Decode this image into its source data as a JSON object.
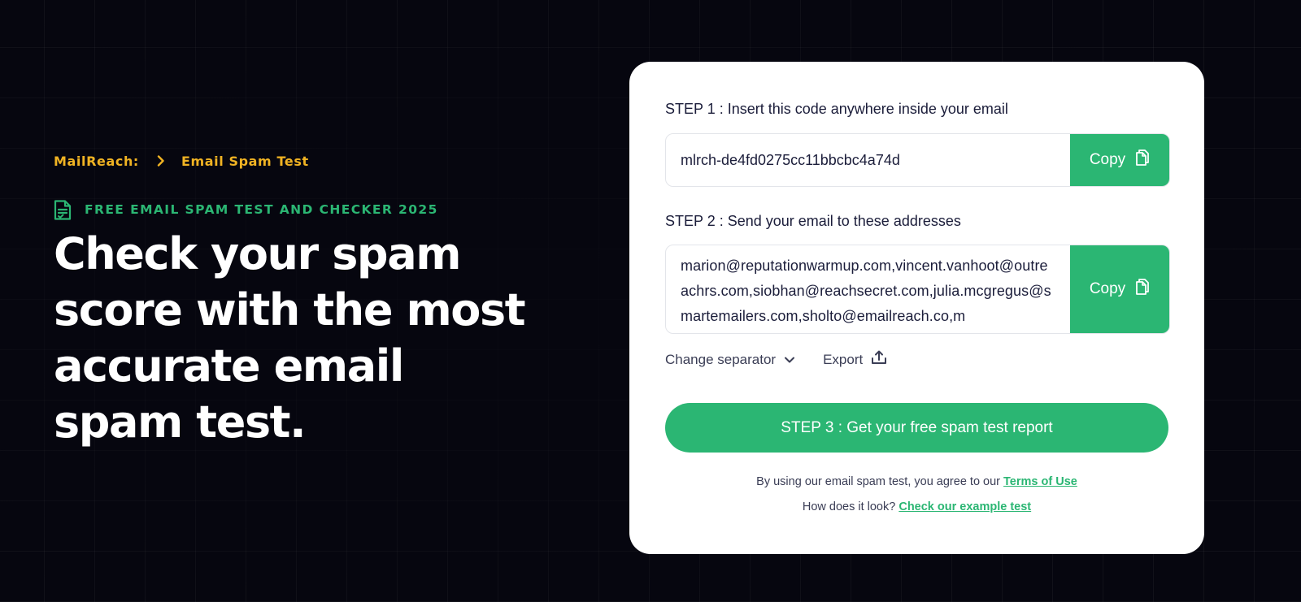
{
  "breadcrumb": {
    "home": "MailReach:",
    "current": "Email Spam Test"
  },
  "hero": {
    "eyebrow": "FREE EMAIL SPAM TEST AND CHECKER 2025",
    "headline": "Check your spam score with the most accurate email spam test."
  },
  "card": {
    "step1": {
      "label": "STEP 1 : Insert this code anywhere inside your email",
      "code": "mlrch-de4fd0275cc11bbcbc4a74d",
      "copy_label": "Copy"
    },
    "step2": {
      "label": "STEP 2 : Send your email to these addresses",
      "addresses": "marion@reputationwarmup.com,vincent.vanhoot@outreachrs.com,siobhan@reachsecret.com,julia.mcgregus@smartemailers.com,sholto@emailreach.co,m",
      "copy_label": "Copy"
    },
    "tools": {
      "separator_label": "Change separator",
      "export_label": "Export"
    },
    "step3": {
      "label": "STEP 3 : Get your free spam test report"
    },
    "terms": {
      "text": "By using our email spam test, you agree to our ",
      "link": "Terms of Use"
    },
    "example": {
      "text": "How does it look? ",
      "link": "Check our example test"
    }
  },
  "colors": {
    "background": "#06060f",
    "accent_green": "#2bb673",
    "accent_yellow": "#f0b323",
    "card_text": "#1b1d3a"
  },
  "icons": {
    "breadcrumb_separator": "chevron-right-icon",
    "eyebrow": "document-check-icon",
    "copy": "copy-icon",
    "separator_dropdown": "chevron-down-icon",
    "export": "upload-icon"
  }
}
